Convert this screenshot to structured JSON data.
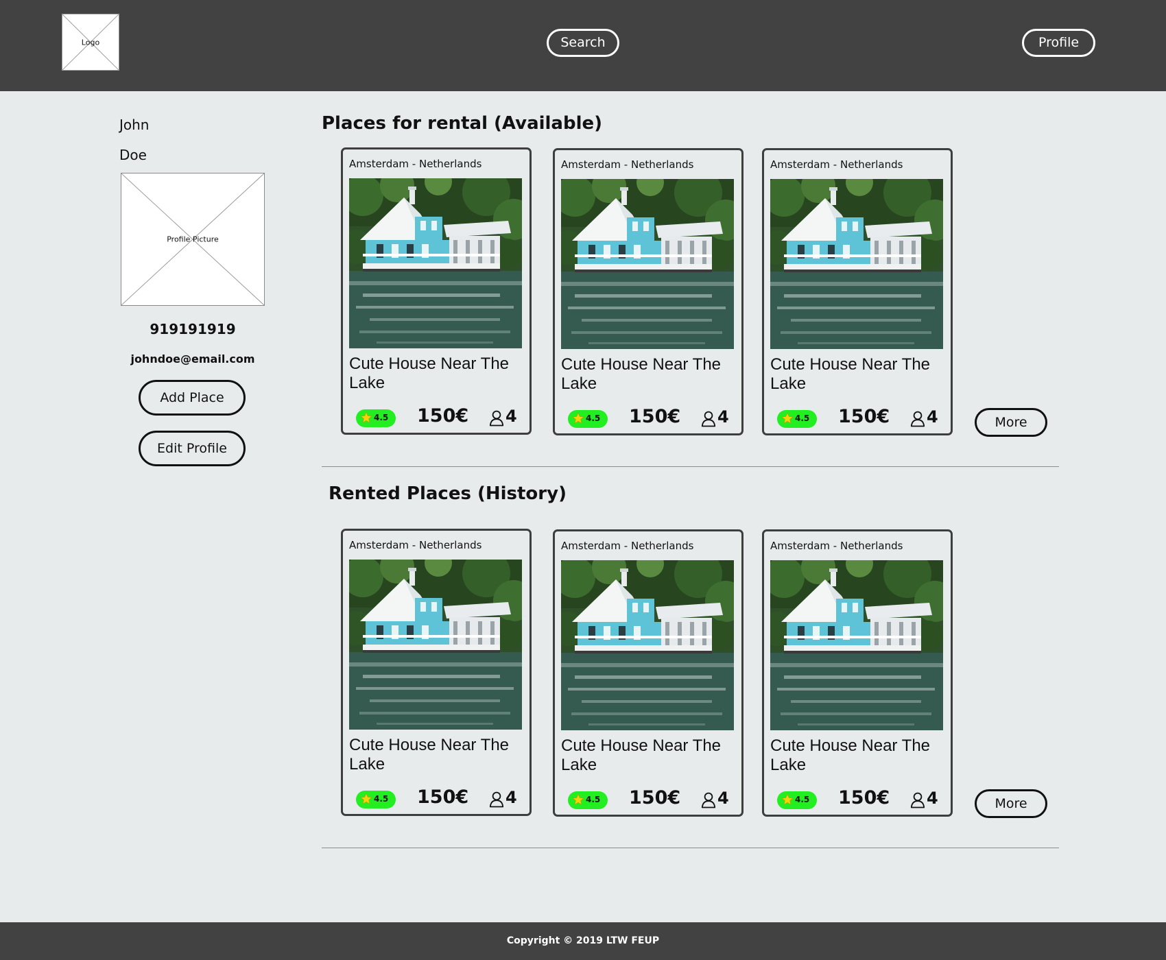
{
  "header": {
    "logo_label": "Logo",
    "search_label": "Search",
    "profile_label": "Profile"
  },
  "user": {
    "first_name": "John",
    "last_name": "Doe",
    "picture_label": "Profile Picture",
    "phone": "919191919",
    "email": "johndoe@email.com",
    "add_place_label": "Add Place",
    "edit_profile_label": "Edit Profile"
  },
  "available": {
    "title": "Places for rental (Available)",
    "more_label": "More",
    "cards": [
      {
        "location": "Amsterdam - Netherlands",
        "title": "Cute House Near The Lake",
        "rating": "4.5",
        "price": "150€",
        "guests": "4"
      },
      {
        "location": "Amsterdam - Netherlands",
        "title": "Cute House Near The Lake",
        "rating": "4.5",
        "price": "150€",
        "guests": "4"
      },
      {
        "location": "Amsterdam - Netherlands",
        "title": "Cute House Near The Lake",
        "rating": "4.5",
        "price": "150€",
        "guests": "4"
      }
    ]
  },
  "history": {
    "title": "Rented Places (History)",
    "more_label": "More",
    "cards": [
      {
        "location": "Amsterdam - Netherlands",
        "title": "Cute House Near The Lake",
        "rating": "4.5",
        "price": "150€",
        "guests": "4"
      },
      {
        "location": "Amsterdam - Netherlands",
        "title": "Cute House Near The Lake",
        "rating": "4.5",
        "price": "150€",
        "guests": "4"
      },
      {
        "location": "Amsterdam - Netherlands",
        "title": "Cute House Near The Lake",
        "rating": "4.5",
        "price": "150€",
        "guests": "4"
      }
    ]
  },
  "footer": {
    "copyright": "Copyright © 2019 LTW FEUP"
  },
  "colors": {
    "chrome": "#424242",
    "page_background": "#e8ebec",
    "rating_badge": "#22ee22",
    "star": "#f4d30a"
  }
}
